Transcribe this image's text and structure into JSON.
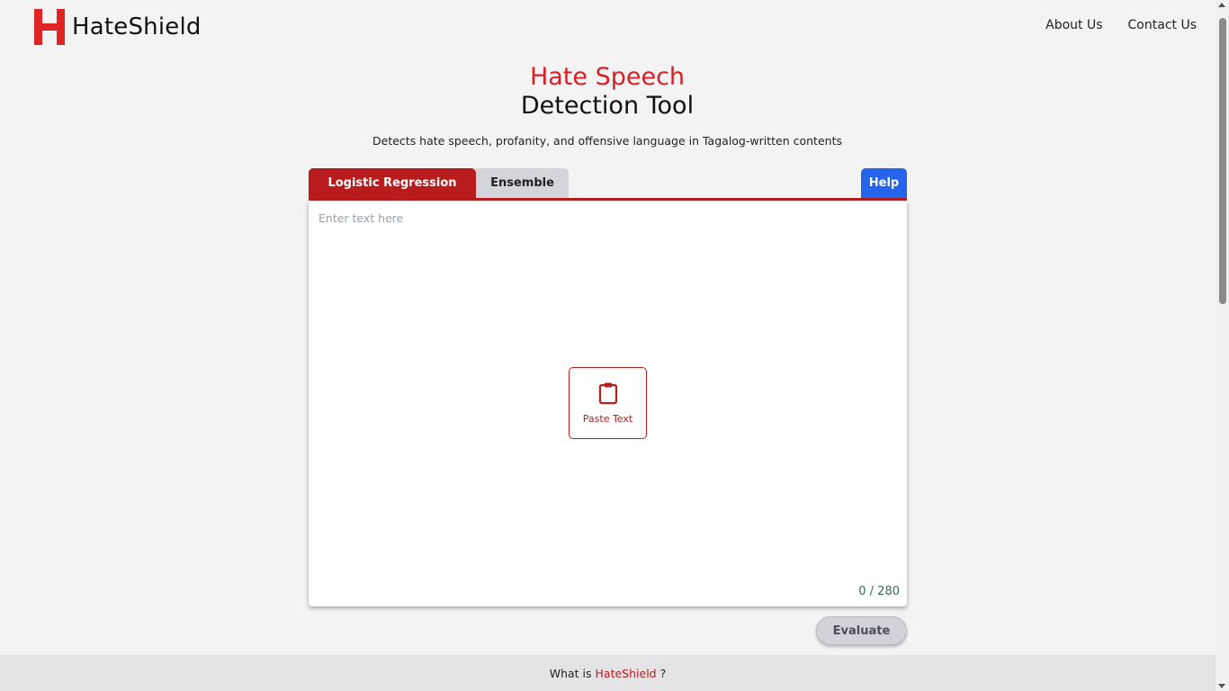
{
  "header": {
    "brand": "HateShield",
    "nav": [
      {
        "label": "About Us"
      },
      {
        "label": "Contact Us"
      }
    ]
  },
  "hero": {
    "title_line1": "Hate Speech",
    "title_line2": "Detection Tool",
    "subtitle": "Detects hate speech, profanity, and offensive language in Tagalog-written contents"
  },
  "tabs": {
    "active": "Logistic Regression",
    "items": [
      {
        "label": "Logistic Regression"
      },
      {
        "label": "Ensemble"
      }
    ],
    "help_label": "Help"
  },
  "editor": {
    "placeholder": "Enter text here",
    "value": "",
    "paste_label": "Paste Text",
    "counter": "0 / 280"
  },
  "actions": {
    "evaluate_label": "Evaluate"
  },
  "footer": {
    "prefix": "What is",
    "brand": "HateShield",
    "suffix": "?"
  },
  "icons": {
    "logo": "h-logo-icon",
    "paste": "clipboard-icon"
  },
  "colors": {
    "brand_red": "#d91f26",
    "tab_active": "#b91c1c",
    "help_blue": "#2563eb",
    "counter_green": "#2e6f56"
  }
}
